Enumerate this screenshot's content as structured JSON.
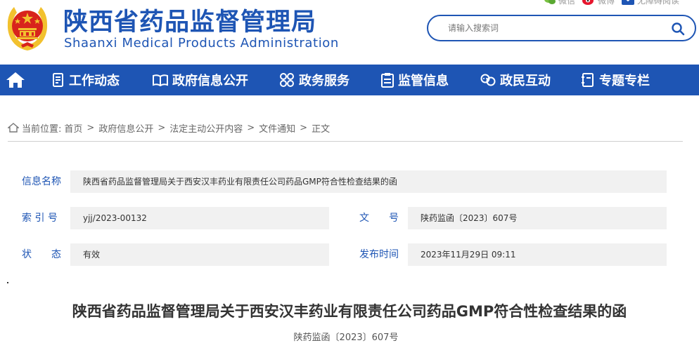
{
  "header": {
    "site_title": "陕西省药品监督管理局",
    "site_subtitle": "Shaanxi Medical Products Administration",
    "links": {
      "wechat": "微信",
      "weibo": "微博",
      "accessibility": "无障碍阅读"
    },
    "search": {
      "placeholder": "请输入搜索词",
      "value": ""
    }
  },
  "nav": {
    "items": [
      {
        "label": "工作动态",
        "icon": "document-list-icon"
      },
      {
        "label": "政府信息公开",
        "icon": "open-book-icon"
      },
      {
        "label": "政务服务",
        "icon": "service-grid-icon"
      },
      {
        "label": "监管信息",
        "icon": "clipboard-icon"
      },
      {
        "label": "政民互动",
        "icon": "interaction-icon"
      },
      {
        "label": "专题专栏",
        "icon": "notebook-icon"
      }
    ]
  },
  "breadcrumb": {
    "prefix": "当前位置:",
    "items": [
      "首页",
      "政府信息公开",
      "法定主动公开内容",
      "文件通知",
      "正文"
    ]
  },
  "meta": {
    "info_name_label": "信息名称",
    "info_name_value": "陕西省药品监督管理局关于西安汉丰药业有限责任公司药品GMP符合性检查结果的函",
    "index_label": "索 引 号",
    "index_value": "yjj/2023-00132",
    "doc_label": "文　　号",
    "doc_value": "陕药监函〔2023〕607号",
    "status_label": "状　　态",
    "status_value": "有效",
    "date_label": "发布时间",
    "date_value": "2023年11月29日 09:11"
  },
  "document": {
    "title": "陕西省药品监督管理局关于西安汉丰药业有限责任公司药品GMP符合性检查结果的函",
    "number": "陕药监函〔2023〕607号"
  },
  "colors": {
    "brand_blue": "#1e55b4",
    "emblem_red": "#d8241c",
    "emblem_gold": "#f2c12e",
    "meta_bg": "#f1f1f1"
  }
}
